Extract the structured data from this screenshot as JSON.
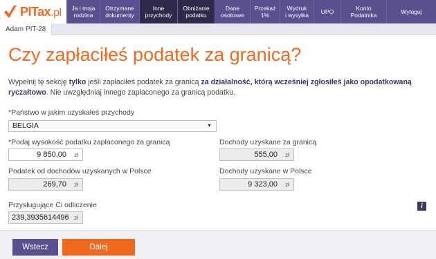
{
  "brand": {
    "name": "PITax",
    "suffix": ".pl",
    "accent": "#ef6a1f",
    "nav_color": "#5c4f8f"
  },
  "nav": [
    {
      "label": "Ja i moja\nrodzina",
      "active": false
    },
    {
      "label": "Otrzymane\ndokumenty",
      "active": false
    },
    {
      "label": "Inne\nprzychody",
      "active": true
    },
    {
      "label": "Obniżanie\npodatku",
      "active": true
    },
    {
      "label": "Dane\nosobowe",
      "active": false
    },
    {
      "label": "Przekaż\n1%",
      "active": false
    },
    {
      "label": "Wydruk\ni wysyłka",
      "active": false
    },
    {
      "label": "UPO",
      "active": false
    },
    {
      "label": "Konto\nPodatnika",
      "active": false
    },
    {
      "label": "Wyloguj",
      "active": false
    }
  ],
  "subtab": "Adam PIT-28",
  "page": {
    "title": "Czy zapłaciłeś podatek za granicą?",
    "intro_1": "Wypełnij tę sekcję ",
    "intro_bold_1": "tylko",
    "intro_2": " jeśli zapłaciłeś podatek za granicą ",
    "intro_bold_2": "za działalność, którą wcześniej zgłosiłeś jako opodatkowaną ryczałtowo",
    "intro_3": ". Nie uwzględniaj innego zapłaconego za granicą podatku."
  },
  "form": {
    "country_label": "Państwo w jakim uzyskałeś przychody",
    "country_value": "BELGIA",
    "tax_paid_label": "Podaj wysokość podatku zapłaconego za granicą",
    "tax_paid_value": "9 850,00",
    "income_abroad_label": "Dochody uzyskane za granicą",
    "income_abroad_value": "555,00",
    "tax_poland_label": "Podatek od dochodów uzyskanych w Polsce",
    "tax_poland_value": "269,70",
    "income_poland_label": "Dochody uzyskane w Polsce",
    "income_poland_value": "9 323,00",
    "deduction_label": "Przysługujące Ci odliczenie",
    "deduction_value": "239,3935614496",
    "unit": "zł",
    "required_mark": "*"
  },
  "buttons": {
    "back": "Wstecz",
    "next": "Dalej"
  },
  "icons": {
    "info": "i",
    "caret": "▼"
  }
}
